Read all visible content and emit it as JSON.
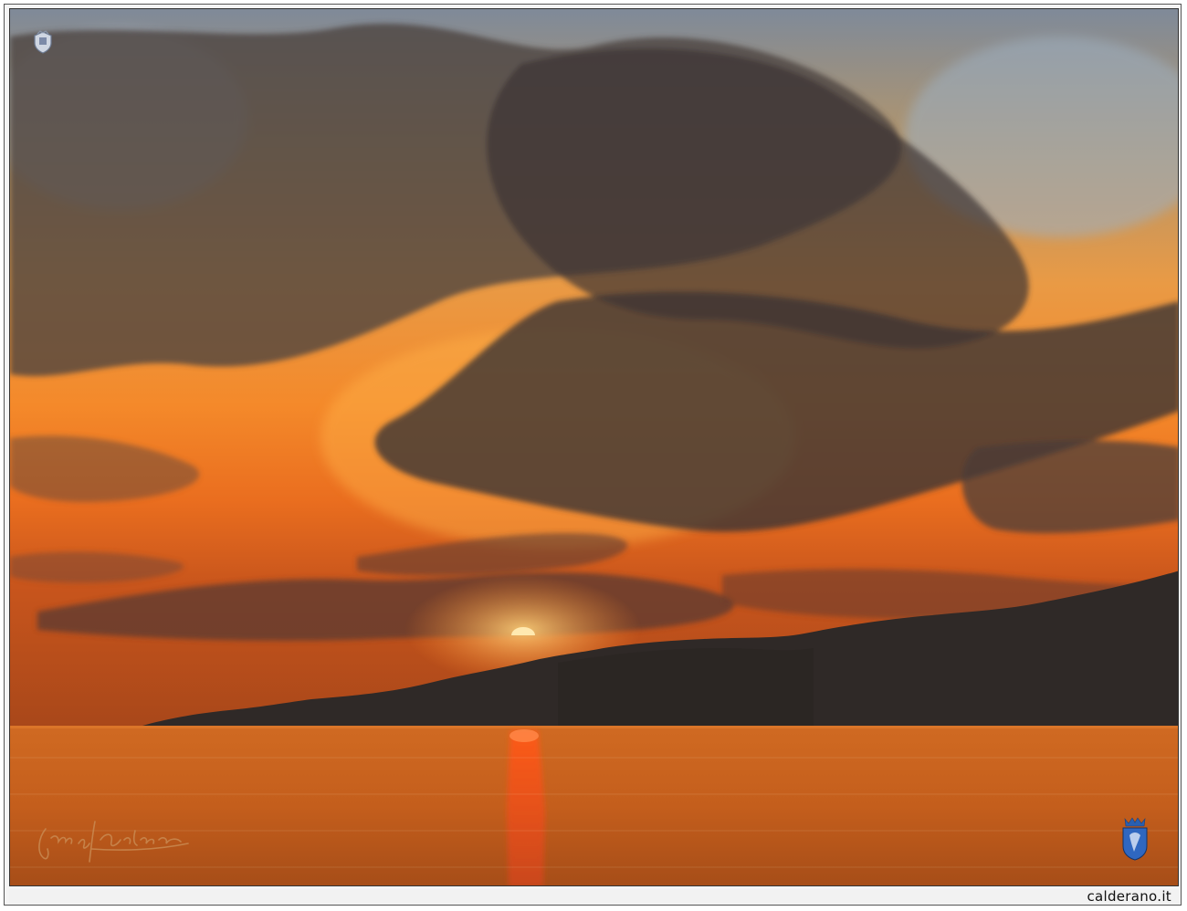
{
  "footer": {
    "site_label": "calderano.it"
  },
  "colors": {
    "sky_top": "#8a95a5",
    "sky_orange": "#f08a2c",
    "sky_horizon": "#d85a1a",
    "cloud_dark": "#3f3a3a",
    "mountain": "#2e2826",
    "sea": "#c8641e",
    "sun": "#ffe7a8"
  },
  "icons": {
    "crest": "crest-logo-icon",
    "signature": "handwritten-signature",
    "badge": "blue-shield-badge-icon"
  }
}
